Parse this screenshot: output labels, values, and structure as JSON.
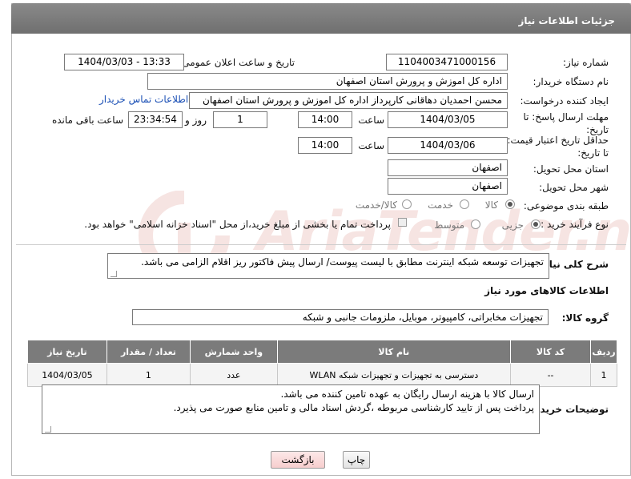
{
  "header": {
    "title": "جزئیات اطلاعات نیاز"
  },
  "fields": {
    "need_number_label": "شماره نیاز:",
    "need_number": "1104003471000156",
    "announce_label": "تاریخ و ساعت اعلان عمومی:",
    "announce_value": "1404/03/03 - 13:33",
    "buyer_org_label": "نام دستگاه خریدار:",
    "buyer_org": "اداره کل اموزش و پرورش استان اصفهان",
    "requester_label": "ایجاد کننده درخواست:",
    "requester": "محسن احمدیان دهاقانی کارپرداز اداره کل اموزش و پرورش استان اصفهان",
    "contact_link": "اطلاعات تماس خریدار",
    "deadline_label": "مهلت ارسال پاسخ: تا تاریخ:",
    "deadline_date": "1404/03/05",
    "time_label": "ساعت",
    "deadline_time": "14:00",
    "days_value": "1",
    "days_label": "روز و",
    "remaining_time": "23:34:54",
    "remaining_label": "ساعت باقی مانده",
    "price_validity_label": "حداقل تاریخ اعتبار قیمت: تا تاریخ:",
    "price_date": "1404/03/06",
    "price_time": "14:00",
    "province_label": "استان محل تحویل:",
    "province": "اصفهان",
    "city_label": "شهر محل تحویل:",
    "city": "اصفهان",
    "category_label": "طبقه بندی موضوعی:",
    "category_options": [
      "کالا",
      "خدمت",
      "کالا/خدمت"
    ],
    "category_selected": "کالا",
    "process_label": "نوع فرآیند خرید :",
    "process_options": [
      "جزیی",
      "متوسط"
    ],
    "process_selected": "جزیی",
    "process_note": "پرداخت تمام یا بخشی از مبلغ خرید،از محل \"اسناد خزانه اسلامی\" خواهد بود.",
    "description_label": "شرح کلی نیاز:",
    "description": "تجهیزات توسعه شبکه اینترنت مطابق با لیست پیوست/ ارسال پیش فاکتور ریز اقلام الزامی می باشد."
  },
  "goods": {
    "section_title": "اطلاعات کالاهای مورد نیاز",
    "group_label": "گروه کالا:",
    "group_value": "تجهیزات مخابراتی، کامپیوتر، موبایل، ملزومات جانبی و شبکه",
    "columns": [
      "ردیف",
      "کد کالا",
      "نام کالا",
      "واحد شمارش",
      "تعداد / مقدار",
      "تاریخ نیاز"
    ],
    "rows": [
      [
        "1",
        "--",
        "دسترسی به تجهیزات و تجهیزات شبکه WLAN",
        "عدد",
        "1",
        "1404/03/05"
      ]
    ]
  },
  "buyer_notes": {
    "label": "توضیحات خریدار:",
    "line1": "ارسال کالا با هزینه ارسال رایگان به عهده تامین کننده می باشد.",
    "line2": "پرداخت پس از تایید کارشناسی مربوطه ،گردش اسناد مالی و تامین منابع صورت می پذیرد."
  },
  "buttons": {
    "print": "چاپ",
    "back": "بازگشت"
  },
  "watermark": {
    "text": "AriaTender.neT"
  },
  "colors": {
    "header_bg": "#7b7b7b",
    "link": "#1a4fb5",
    "watermark": "#c0392b"
  }
}
